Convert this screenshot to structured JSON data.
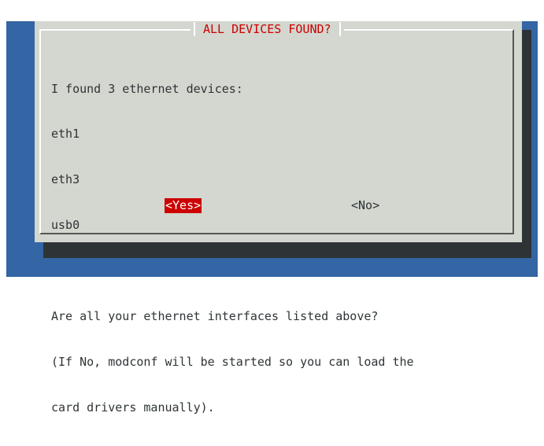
{
  "dialog": {
    "title": "ALL DEVICES FOUND?",
    "lines": [
      "I found 3 ethernet devices:",
      "eth1",
      "eth3",
      "usb0",
      "",
      "Are all your ethernet interfaces listed above?",
      "(If No, modconf will be started so you can load the",
      "card drivers manually)."
    ],
    "yes_label": "<Yes>",
    "no_label": "<No>"
  },
  "colors": {
    "screen_background": "#3465a4",
    "dialog_background": "#d3d7cf",
    "title_color": "#cc0000",
    "selected_button_background": "#cc0000",
    "selected_button_text": "#ffffff",
    "text_color": "#2e3436",
    "shadow": "#2e3436"
  }
}
